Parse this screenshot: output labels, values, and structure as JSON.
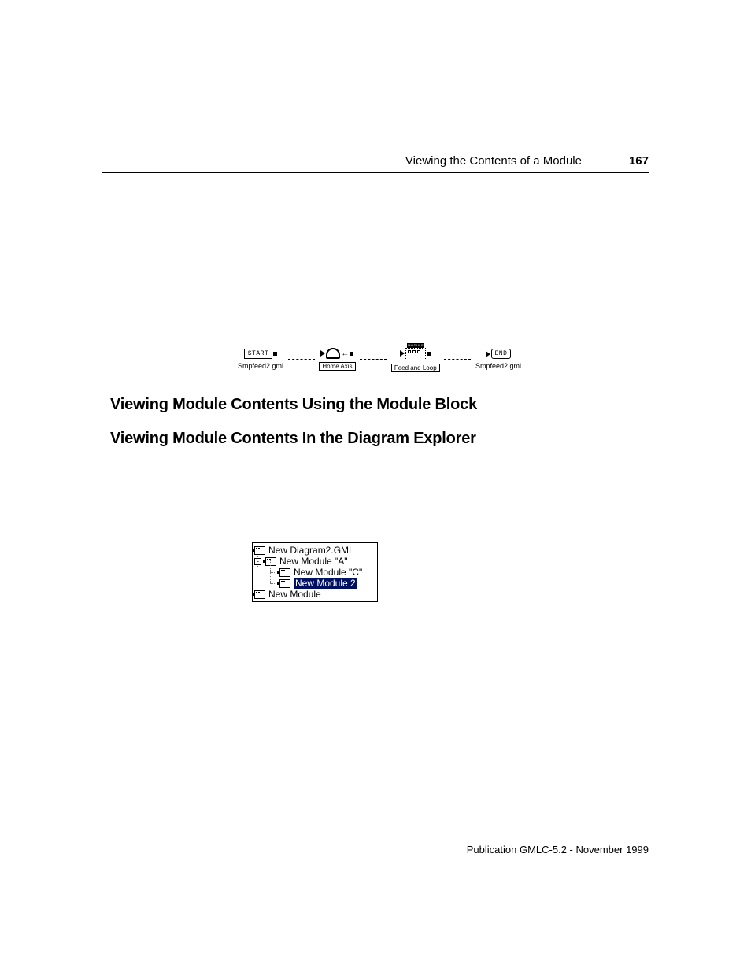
{
  "header": {
    "section_title": "Viewing the Contents of a Module",
    "page_number": "167"
  },
  "diagram": {
    "start": {
      "icon_text": "START",
      "caption": "Smpfeed2.gml"
    },
    "home": {
      "caption": "Home Axis"
    },
    "module": {
      "top_label": "MODULE",
      "caption": "Feed and Loop"
    },
    "end": {
      "icon_text": "END",
      "caption": "Smpfeed2.gml"
    }
  },
  "headings": {
    "h1": "Viewing Module Contents Using the Module Block",
    "h2": "Viewing Module Contents In the Diagram Explorer"
  },
  "tree": {
    "root1": "New Diagram2.GML",
    "child1": "New Module \"A\"",
    "grandchild1": "New Module \"C\"",
    "grandchild2": "New Module 2",
    "root2": "New Module"
  },
  "footer": "Publication GMLC-5.2 - November 1999"
}
